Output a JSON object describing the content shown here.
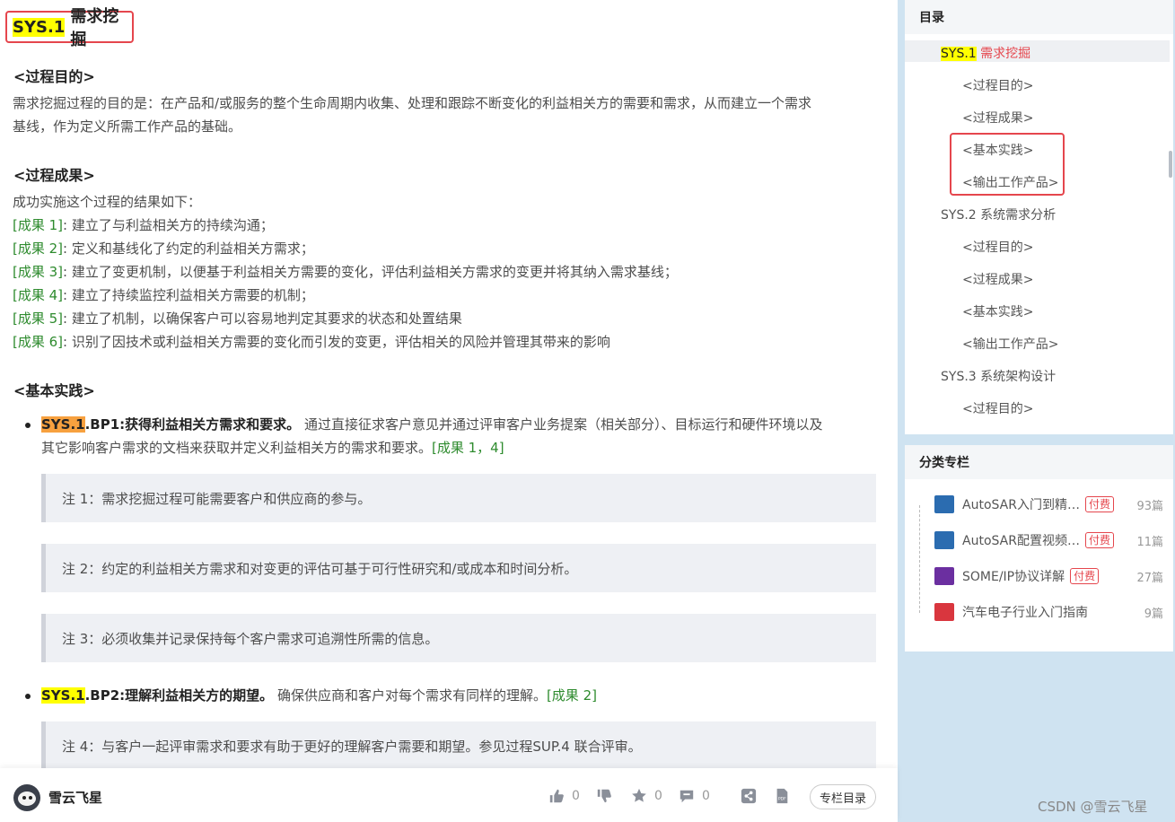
{
  "article": {
    "title_tag": "SYS.1",
    "title_text": "需求挖掘",
    "h_purpose": "<过程目的>",
    "purpose_line1": "需求挖掘过程的目的是：在产品和/或服务的整个生命周期内收集、处理和跟踪不断变化的利益相关方的需要和需求，从而建立一个需求",
    "purpose_line2": "基线，作为定义所需工作产品的基础。",
    "h_outcomes": "<过程成果>",
    "outcomes_intro": "成功实施这个过程的结果如下：",
    "outcomes": [
      {
        "tag": "[成果 1]",
        "text": ": 建立了与利益相关方的持续沟通；"
      },
      {
        "tag": "[成果 2]",
        "text": ": 定义和基线化了约定的利益相关方需求；"
      },
      {
        "tag": "[成果 3]",
        "text": ": 建立了变更机制，以便基于利益相关方需要的变化，评估利益相关方需求的变更并将其纳入需求基线；"
      },
      {
        "tag": "[成果 4]",
        "text": ": 建立了持续监控利益相关方需要的机制；"
      },
      {
        "tag": "[成果 5]",
        "text": ": 建立了机制，以确保客户可以容易地判定其要求的状态和处置结果"
      },
      {
        "tag": "[成果 6]",
        "text": ": 识别了因技术或利益相关方需要的变化而引发的变更，评估相关的风险并管理其带来的影响"
      }
    ],
    "h_practices": "<基本实践>",
    "bp1": {
      "tag": "SYS.1",
      "title": ".BP1:获得利益相关方需求和要求。",
      "line1": " 通过直接征求客户意见并通过评审客户业务提案（相关部分）、目标运行和硬件环境以及",
      "line2": "其它影响客户需求的文档来获取并定义利益相关方的需求和要求。",
      "ref": "[成果 1，4]"
    },
    "notes": [
      "注 1：需求挖掘过程可能需要客户和供应商的参与。",
      "注 2：约定的利益相关方需求和对变更的评估可基于可行性研究和/或成本和时间分析。",
      "注 3：必须收集并记录保持每个客户需求可追溯性所需的信息。",
      "注 4：与客户一起评审需求和要求有助于更好的理解客户需要和期望。参见过程SUP.4 联合评审。"
    ],
    "bp2": {
      "tag": "SYS.1",
      "title": ".BP2:理解利益相关方的期望。",
      "text": " 确保供应商和客户对每个需求有同样的理解。",
      "ref": "[成果 2]"
    }
  },
  "footer": {
    "author": "雪云飞星",
    "likes": "0",
    "stars": "0",
    "comments": "0",
    "toc_button": "专栏目录",
    "watermark": "CSDN @雪云飞星"
  },
  "toc": {
    "heading": "目录",
    "active_tag": "SYS.1",
    "active_text": " 需求挖掘",
    "items": [
      "<过程目的>",
      "<过程成果>",
      "<基本实践>",
      "<输出工作产品>",
      "SYS.2 系统需求分析",
      "<过程目的>",
      "<过程成果>",
      "<基本实践>",
      "<输出工作产品>",
      "SYS.3 系统架构设计",
      "<过程目的>"
    ]
  },
  "categories": {
    "heading": "分类专栏",
    "paid_label": "付费",
    "items": [
      {
        "name": "AutoSAR入门到精…",
        "paid": true,
        "count": "93篇",
        "color": "#2b6cb0"
      },
      {
        "name": "AutoSAR配置视频…",
        "paid": true,
        "count": "11篇",
        "color": "#2b6cb0"
      },
      {
        "name": "SOME/IP协议详解",
        "paid": true,
        "count": "27篇",
        "color": "#6b2fa0"
      },
      {
        "name": "汽车电子行业入门指南",
        "paid": false,
        "count": "9篇",
        "color": "#d9363e"
      }
    ]
  },
  "colors": {
    "accent_red": "#e5464d",
    "green_ref": "#2e8b2e",
    "highlight_yellow": "#ffff00",
    "highlight_orange": "#f7a13f"
  }
}
